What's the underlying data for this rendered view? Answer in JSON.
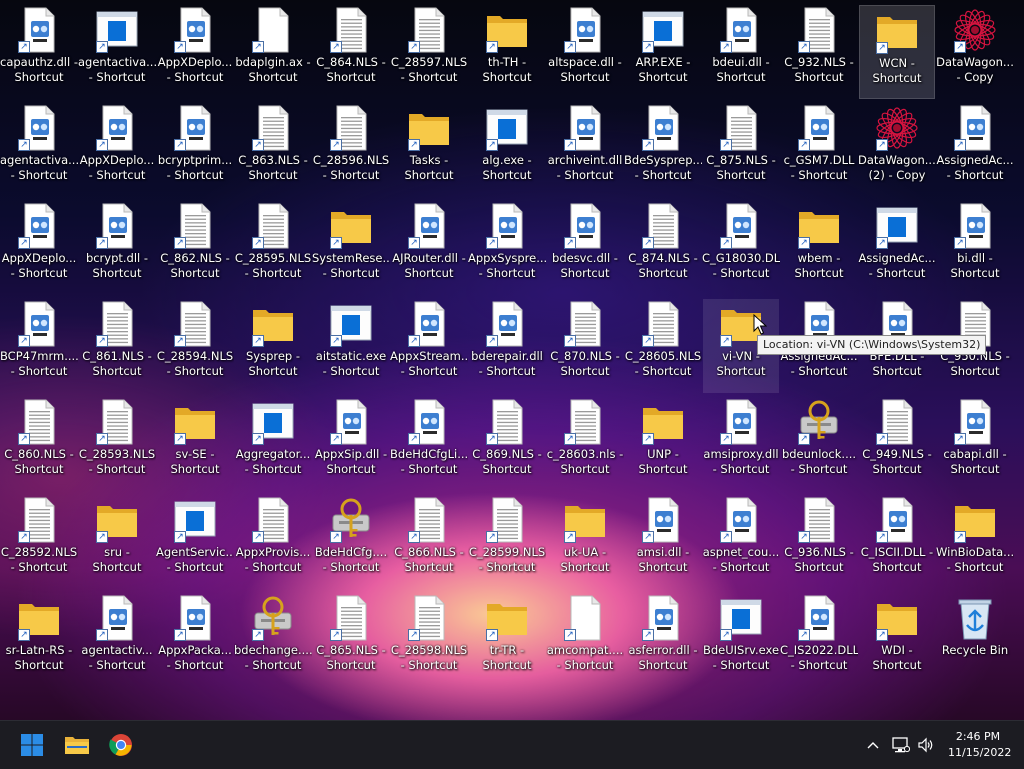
{
  "desktop": {
    "icons": [
      [
        "capauthz.dll - Shortcut",
        "agentactiva... - Shortcut",
        "AppXDeplo... - Shortcut",
        "bdaplgin.ax - Shortcut",
        "C_864.NLS - Shortcut",
        "C_28597.NLS - Shortcut",
        "th-TH - Shortcut",
        "altspace.dll - Shortcut",
        "ARP.EXE - Shortcut",
        "bdeui.dll - Shortcut",
        "C_932.NLS - Shortcut",
        "WCN - Shortcut",
        "DataWagon... - Copy"
      ],
      [
        "agentactiva... - Shortcut",
        "AppXDeplo... - Shortcut",
        "bcryptprim... - Shortcut",
        "C_863.NLS - Shortcut",
        "C_28596.NLS - Shortcut",
        "Tasks - Shortcut",
        "alg.exe - Shortcut",
        "archiveint.dll - Shortcut",
        "BdeSysprep.... - Shortcut",
        "C_875.NLS - Shortcut",
        "c_GSM7.DLL - Shortcut",
        "DataWagon.... (2) - Copy",
        "AssignedAc... - Shortcut"
      ],
      [
        "AppXDeplo... - Shortcut",
        "bcrypt.dll - Shortcut",
        "C_862.NLS - Shortcut",
        "C_28595.NLS - Shortcut",
        "SystemRese... - Shortcut",
        "AJRouter.dll - Shortcut",
        "AppxSyspre... - Shortcut",
        "bdesvc.dll - Shortcut",
        "C_874.NLS - Shortcut",
        "C_G18030.DLL - Shortcut",
        "wbem - Shortcut",
        "AssignedAc... - Shortcut",
        "bi.dll - Shortcut"
      ],
      [
        "BCP47mrm.... - Shortcut",
        "C_861.NLS - Shortcut",
        "C_28594.NLS - Shortcut",
        "Sysprep - Shortcut",
        "aitstatic.exe - Shortcut",
        "AppxStream... - Shortcut",
        "bderepair.dll - Shortcut",
        "C_870.NLS - Shortcut",
        "C_28605.NLS - Shortcut",
        "vi-VN - Shortcut",
        "AssignedAc... - Shortcut",
        "BFE.DLL - Shortcut",
        "C_950.NLS - Shortcut"
      ],
      [
        "C_860.NLS - Shortcut",
        "C_28593.NLS - Shortcut",
        "sv-SE - Shortcut",
        "Aggregator... - Shortcut",
        "AppxSip.dll - Shortcut",
        "BdeHdCfgLi... - Shortcut",
        "C_869.NLS - Shortcut",
        "c_28603.nls - Shortcut",
        "UNP - Shortcut",
        "amsiproxy.dll - Shortcut",
        "bdeunlock.... - Shortcut",
        "C_949.NLS - Shortcut",
        "cabapi.dll - Shortcut"
      ],
      [
        "C_28592.NLS - Shortcut",
        "sru - Shortcut",
        "AgentServic... - Shortcut",
        "AppxProvis... - Shortcut",
        "BdeHdCfg.... - Shortcut",
        "C_866.NLS - Shortcut",
        "C_28599.NLS - Shortcut",
        "uk-UA - Shortcut",
        "amsi.dll - Shortcut",
        "aspnet_cou... - Shortcut",
        "C_936.NLS - Shortcut",
        "C_ISCII.DLL - Shortcut",
        "WinBioData... - Shortcut"
      ],
      [
        "sr-Latn-RS - Shortcut",
        "agentactiv... - Shortcut",
        "AppxPacka... - Shortcut",
        "bdechange.... - Shortcut",
        "C_865.NLS - Shortcut",
        "C_28598.NLS - Shortcut",
        "tr-TR - Shortcut",
        "amcompat.... - Shortcut",
        "asferror.dll - Shortcut",
        "BdeUISrv.exe - Shortcut",
        "C_IS2022.DLL - Shortcut",
        "WDI - Shortcut",
        "Recycle Bin"
      ]
    ],
    "types": [
      [
        "dll",
        "exe",
        "dll",
        "page",
        "txt",
        "txt",
        "folder",
        "dll",
        "exe",
        "dll",
        "txt",
        "folder",
        "mandala"
      ],
      [
        "dll",
        "dll",
        "dll",
        "txt",
        "txt",
        "folder",
        "exe",
        "dll",
        "dll",
        "txt",
        "dll",
        "mandala",
        "dll"
      ],
      [
        "dll",
        "dll",
        "txt",
        "txt",
        "folder",
        "dll",
        "dll",
        "dll",
        "txt",
        "dll",
        "folder",
        "exe",
        "dll"
      ],
      [
        "dll",
        "txt",
        "txt",
        "folder",
        "exe",
        "dll",
        "dll",
        "txt",
        "txt",
        "folder",
        "dll",
        "dll",
        "txt"
      ],
      [
        "txt",
        "txt",
        "folder",
        "exe",
        "dll",
        "dll",
        "txt",
        "txt",
        "folder",
        "dll",
        "keys",
        "txt",
        "dll"
      ],
      [
        "txt",
        "folder",
        "exe",
        "txt",
        "keys",
        "txt",
        "txt",
        "folder",
        "dll",
        "dll",
        "txt",
        "dll",
        "folder"
      ],
      [
        "folder",
        "dll",
        "dll",
        "keys",
        "txt",
        "txt",
        "folder",
        "page",
        "dll",
        "exe",
        "dll",
        "folder",
        "bin"
      ]
    ],
    "selected_icon": "WCN - Shortcut",
    "hovered_icon": "vi-VN - Shortcut"
  },
  "tooltip": {
    "text": "Location: vi-VN (C:\\Windows\\System32)"
  },
  "taskbar": {
    "pinned": [
      "start-button",
      "file-explorer",
      "chrome"
    ],
    "clock": {
      "time": "2:46 PM",
      "date": "11/15/2022"
    }
  },
  "colors": {
    "taskbar": "#1c1c22",
    "folder": "#f7c948",
    "windows_blue": "#0a6fd6"
  }
}
